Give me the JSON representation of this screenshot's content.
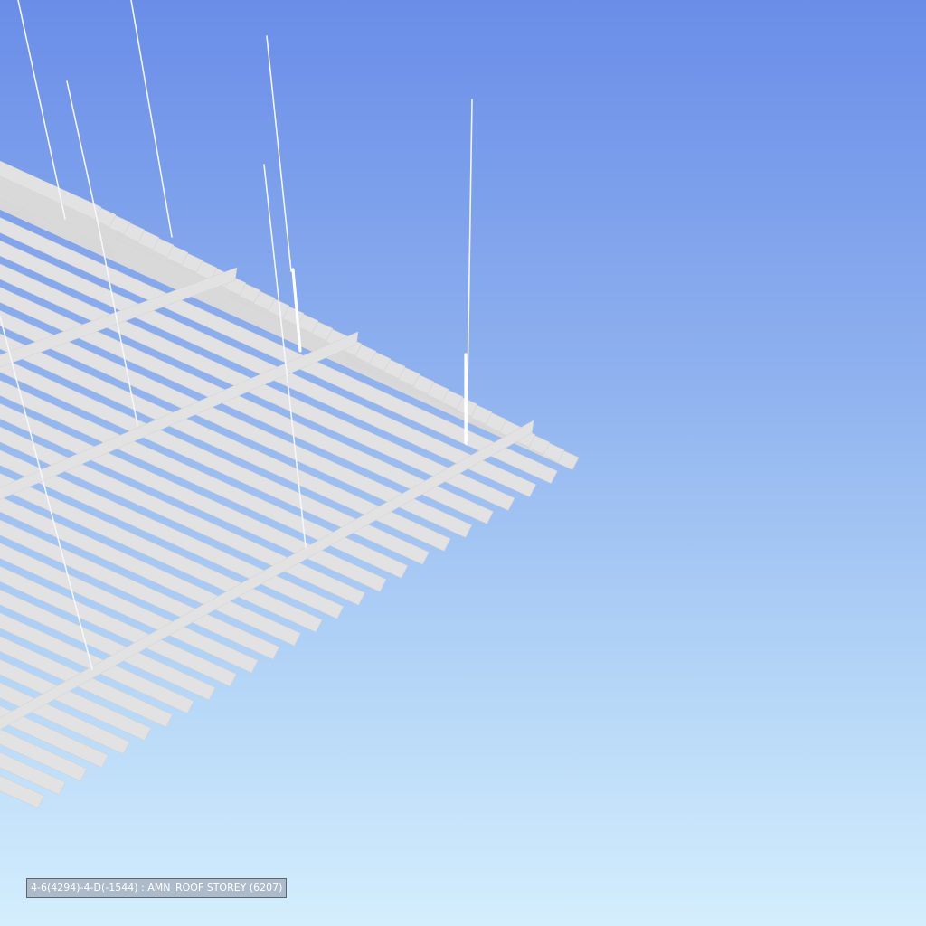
{
  "viewport": {
    "status_label": "4-6(4294)-4-D(-1544) : AMN_ROOF STOREY (6207)"
  },
  "colors": {
    "sky_top": "#6a8de8",
    "sky_bottom": "#d4eefd",
    "slat": "#e2e2e2",
    "hanger": "#f4f6fa"
  }
}
